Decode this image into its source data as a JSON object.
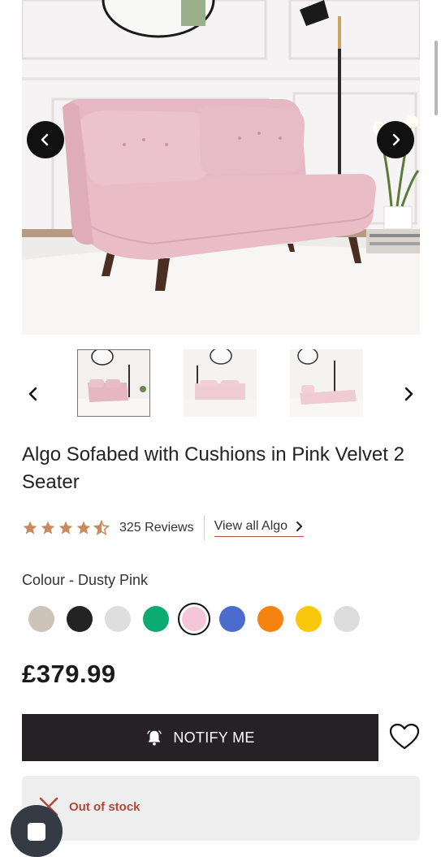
{
  "product": {
    "title": "Algo Sofabed with Cushions in Pink Velvet 2 Seater",
    "rating": 4.5,
    "reviews_label": "325 Reviews",
    "view_all_label": "View all Algo",
    "colour_label": "Colour - Dusty Pink",
    "price": "£379.99",
    "notify_label": "NOTIFY ME",
    "stock_status": "Out of stock"
  },
  "swatches": [
    {
      "name": "beige",
      "color": "#cdc3b8"
    },
    {
      "name": "black",
      "color": "#232323"
    },
    {
      "name": "light-grey",
      "color": "#dedede"
    },
    {
      "name": "green",
      "color": "#0bab73"
    },
    {
      "name": "dusty-pink",
      "color": "#f4c6d8",
      "selected": true
    },
    {
      "name": "blue",
      "color": "#4b6ccc"
    },
    {
      "name": "orange",
      "color": "#f6820f"
    },
    {
      "name": "yellow",
      "color": "#f9c70c"
    },
    {
      "name": "silver",
      "color": "#dcdcdc"
    }
  ],
  "colors": {
    "star": "#c98a5e",
    "notify_bg": "#262124",
    "stock_text": "#b0483a"
  }
}
